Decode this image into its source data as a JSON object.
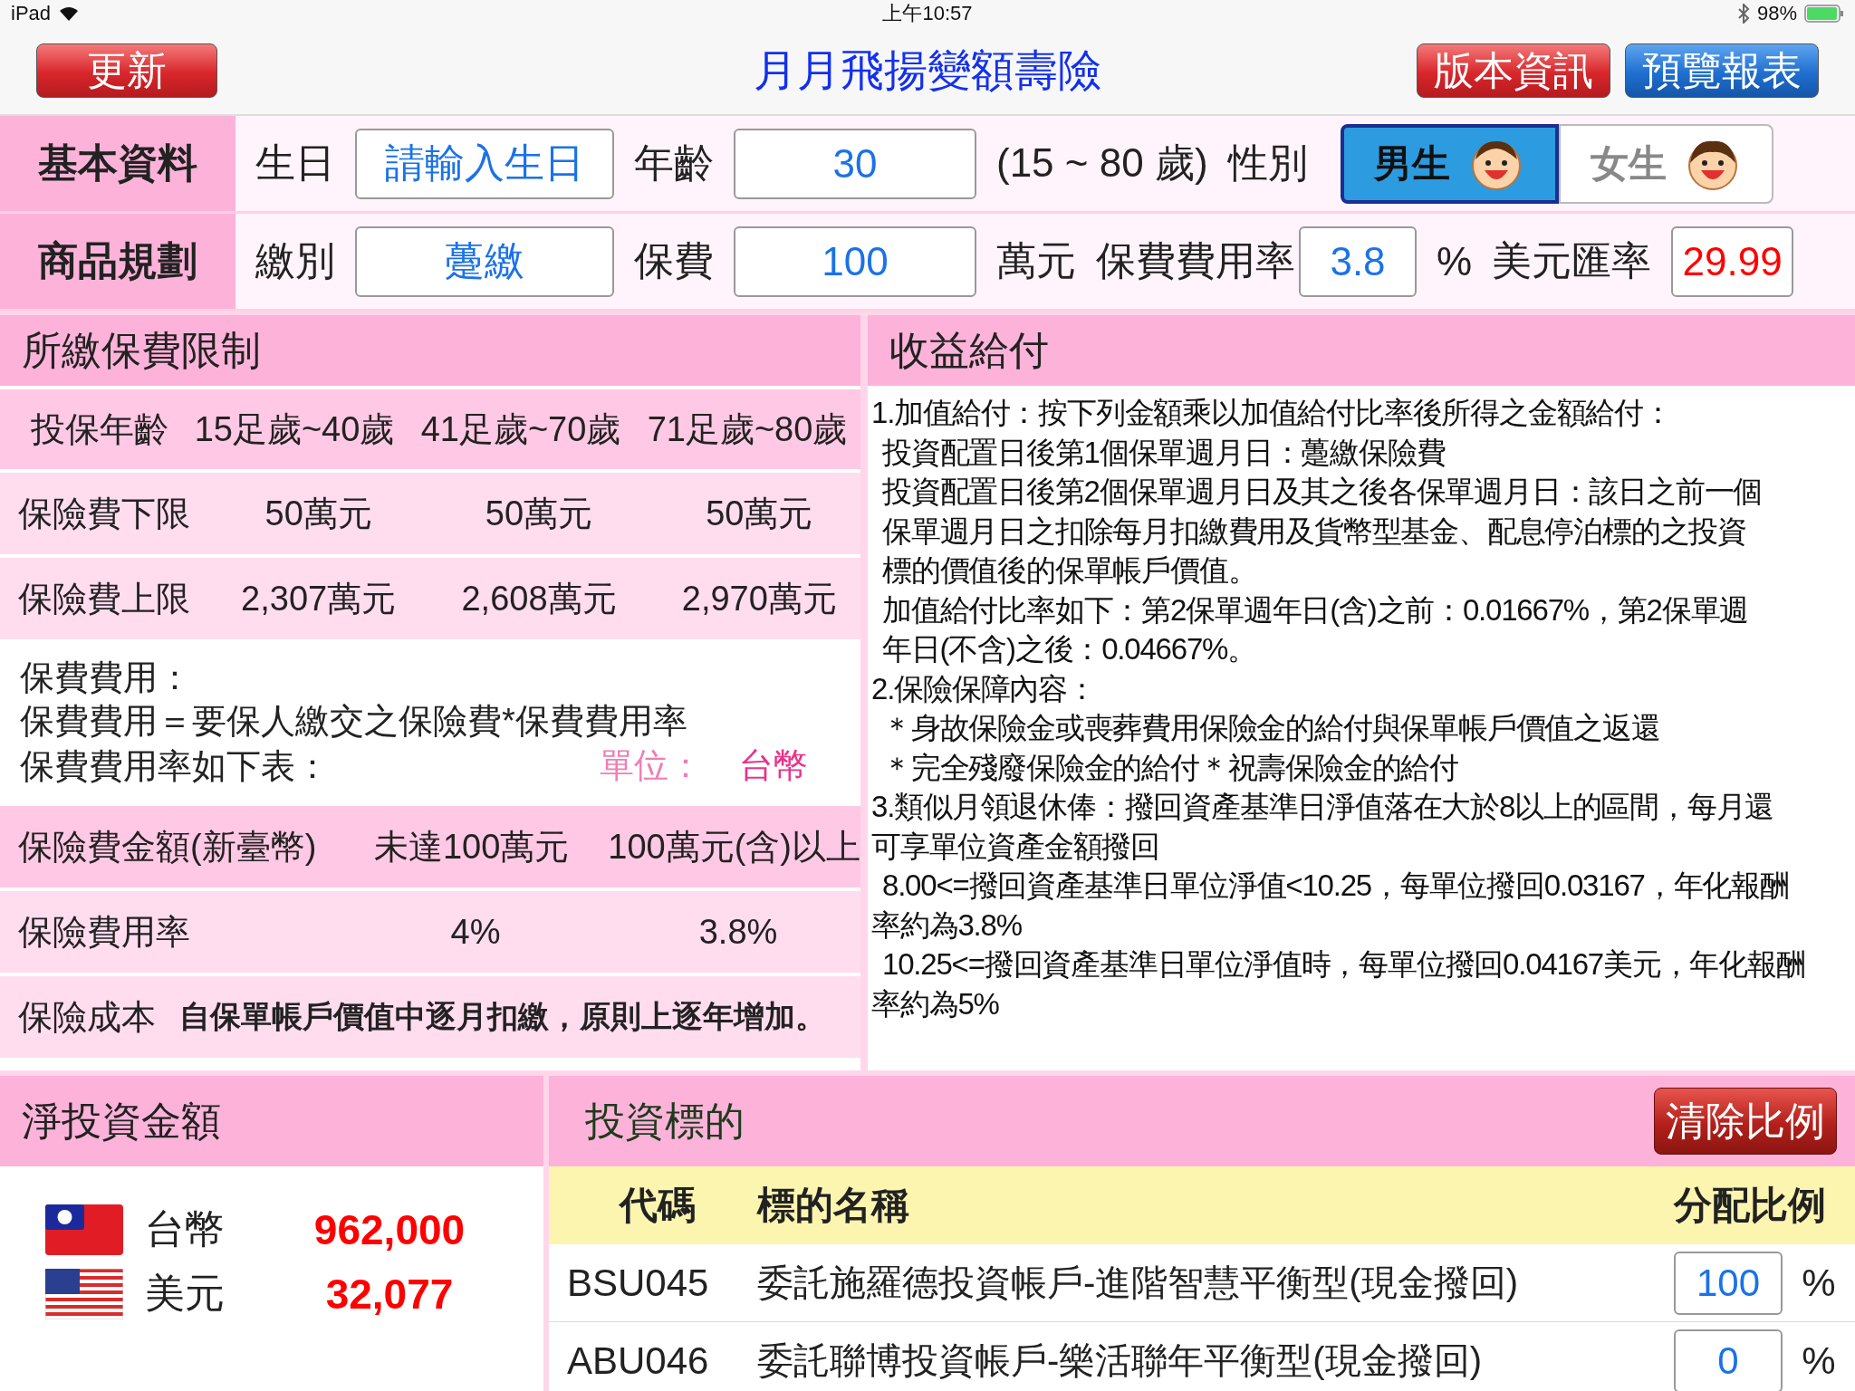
{
  "status_bar": {
    "device": "iPad",
    "time": "上午10:57",
    "battery": "98%"
  },
  "nav": {
    "left_button": "更新",
    "title": "月月飛揚變額壽險",
    "right_buttons": [
      "版本資訊",
      "預覽報表"
    ]
  },
  "basic": {
    "label": "基本資料",
    "birthday_label": "生日",
    "birthday_placeholder": "請輸入生日",
    "age_label": "年齡",
    "age": "30",
    "age_range": "(15 ~ 80 歲)",
    "gender_label": "性別",
    "genders": [
      {
        "label": "男生",
        "selected": true
      },
      {
        "label": "女生",
        "selected": false
      }
    ]
  },
  "plan": {
    "label": "商品規劃",
    "pay_label": "繳別",
    "pay": "躉繳",
    "premium_label": "保費",
    "premium": "100",
    "premium_unit": "萬元",
    "fee_rate_label": "保費費用率",
    "fee_rate": "3.8",
    "percent": "%",
    "fx_label": "美元匯率",
    "fx": "29.99"
  },
  "limits": {
    "title": "所繳保費限制",
    "age_row": [
      "投保年齡",
      "15足歲~40歲",
      "41足歲~70歲",
      "71足歲~80歲"
    ],
    "rows": [
      [
        "保險費下限",
        "50萬元",
        "50萬元",
        "50萬元"
      ],
      [
        "保險費上限",
        "2,307萬元",
        "2,608萬元",
        "2,970萬元"
      ]
    ],
    "fee_note": [
      "保費費用：",
      "保費費用＝要保人繳交之保險費*保費費用率",
      "保費費用率如下表："
    ],
    "unit_label": "單位：",
    "unit": "台幣",
    "fee_header": [
      "保險費金額(新臺幣)",
      "未達100萬元",
      "100萬元(含)以上"
    ],
    "fee_row": [
      "保險費用率",
      "4%",
      "3.8%"
    ],
    "cost": [
      "保險成本",
      "自保單帳戶價值中逐月扣繳，原則上逐年增加。"
    ]
  },
  "benefits": {
    "title": "收益給付",
    "lines": [
      {
        "text": "1.加值給付：按下列金額乘以加值給付比率後所得之金額給付：",
        "indent": false
      },
      {
        "text": "投資配置日後第1個保單週月日：躉繳保險費",
        "indent": true
      },
      {
        "text": "投資配置日後第2個保單週月日及其之後各保單週月日：該日之前一個",
        "indent": true
      },
      {
        "text": "保單週月日之扣除每月扣繳費用及貨幣型基金、配息停泊標的之投資",
        "indent": true
      },
      {
        "text": "標的價值後的保單帳戶價值。",
        "indent": true
      },
      {
        "text": "加值給付比率如下：第2保單週年日(含)之前：0.01667%，第2保單週",
        "indent": true
      },
      {
        "text": "年日(不含)之後：0.04667%。",
        "indent": true
      },
      {
        "text": "2.保險保障內容：",
        "indent": false
      },
      {
        "text": "＊身故保險金或喪葬費用保險金的給付與保單帳戶價值之返還",
        "indent": true
      },
      {
        "text": "＊完全殘廢保險金的給付＊祝壽保險金的給付",
        "indent": true
      },
      {
        "text": "3.類似月領退休俸：撥回資產基準日淨值落在大於8以上的區間，每月還",
        "indent": false
      },
      {
        "text": "可享單位資產金額撥回",
        "indent": false
      },
      {
        "text": "8.00<=撥回資產基準日單位淨值<10.25，每單位撥回0.03167，年化報酬",
        "indent": true
      },
      {
        "text": "率約為3.8%",
        "indent": false
      },
      {
        "text": "10.25<=撥回資產基準日單位淨值時，每單位撥回0.04167美元，年化報酬",
        "indent": true
      },
      {
        "text": "率約為5%",
        "indent": false
      }
    ]
  },
  "net": {
    "title": "淨投資金額",
    "currencies": [
      {
        "kind": "twd",
        "label": "台幣",
        "amount": "962,000"
      },
      {
        "kind": "usd",
        "label": "美元",
        "amount": "32,077"
      }
    ]
  },
  "funds": {
    "title": "投資標的",
    "clear_button": "清除比例",
    "columns": [
      "代碼",
      "標的名稱",
      "分配比例"
    ],
    "rows": [
      {
        "code": "BSU045",
        "name": "委託施羅德投資帳戶-進階智慧平衡型(現金撥回)",
        "ratio": "100",
        "unit": "%"
      },
      {
        "code": "ABU046",
        "name": "委託聯博投資帳戶-樂活聯年平衡型(現金撥回)",
        "ratio": "0",
        "unit": "%"
      }
    ]
  }
}
